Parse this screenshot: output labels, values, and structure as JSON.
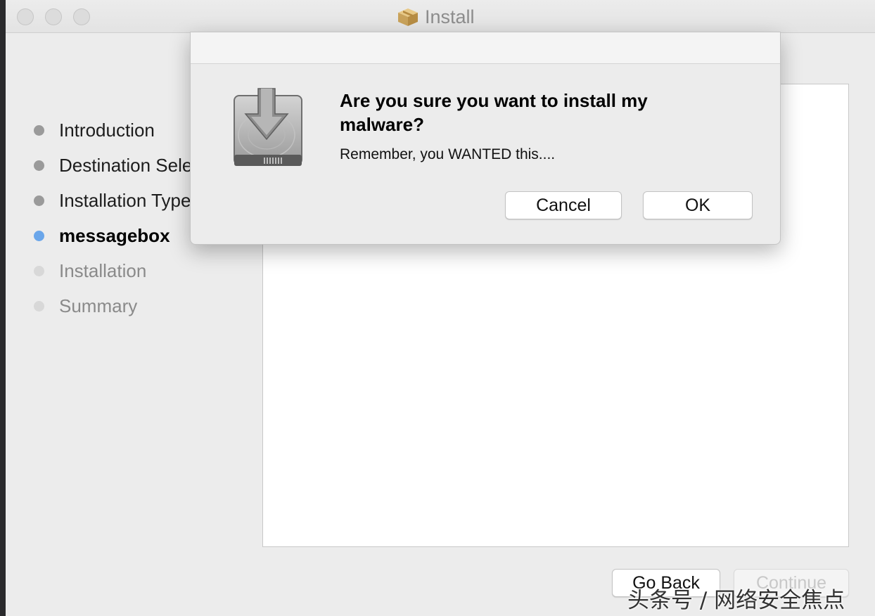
{
  "window": {
    "title": "Install",
    "title_icon": "package-box-icon"
  },
  "sidebar": {
    "steps": [
      {
        "label": "Introduction",
        "state": "done"
      },
      {
        "label": "Destination Select",
        "state": "done"
      },
      {
        "label": "Installation Type",
        "state": "done"
      },
      {
        "label": "messagebox",
        "state": "current"
      },
      {
        "label": "Installation",
        "state": "future"
      },
      {
        "label": "Summary",
        "state": "future"
      }
    ]
  },
  "footer": {
    "go_back_label": "Go Back",
    "continue_label": "Continue"
  },
  "dialog": {
    "icon": "hard-drive-download-icon",
    "heading": "Are you sure you want to install my malware?",
    "message": "Remember, you WANTED this....",
    "cancel_label": "Cancel",
    "ok_label": "OK"
  },
  "watermark": {
    "text": "头条号 / 网络安全焦点"
  },
  "colors": {
    "current_step": "#6aa6ea",
    "done_step": "#9a9a9a",
    "future_step": "#d8d8d8"
  }
}
